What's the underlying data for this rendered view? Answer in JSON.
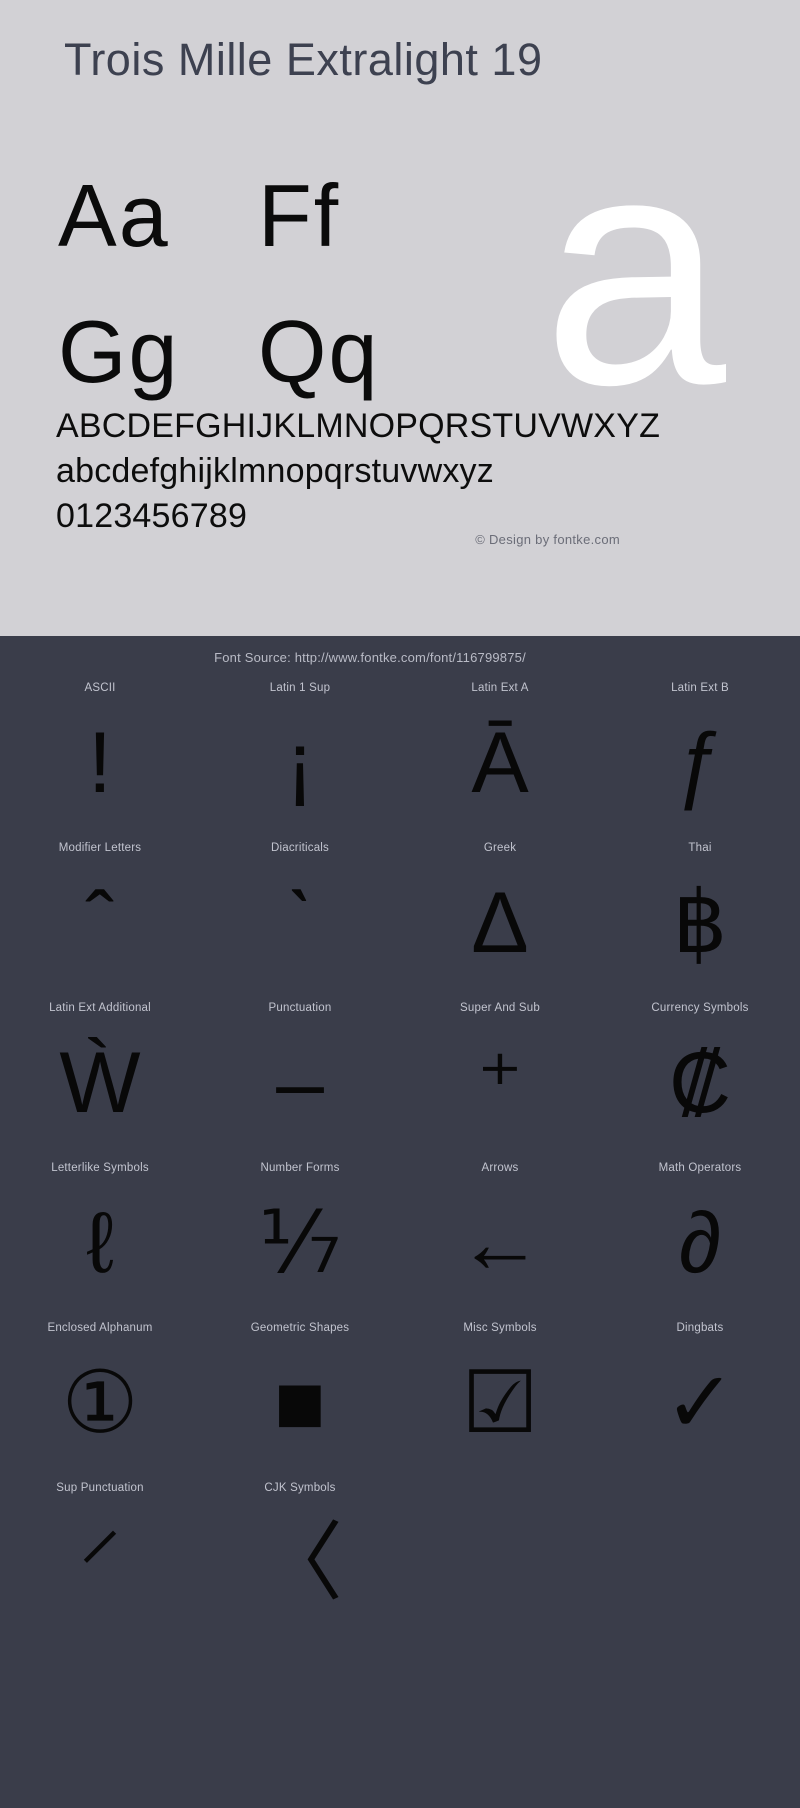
{
  "specimen": {
    "title": "Trois Mille Extralight 19",
    "sample_pairs_row1": [
      "Aa",
      "Ff"
    ],
    "sample_pairs_row2": [
      "Gg",
      "Qq"
    ],
    "ghost_letter": "a",
    "uppercase": "ABCDEFGHIJKLMNOPQRSTUVWXYZ",
    "lowercase": "abcdefghijklmnopqrstuvwxyz",
    "digits": "0123456789",
    "credit": "© Design by fontke.com",
    "background_color": "#d2d1d5",
    "title_color": "#3d4150",
    "glyph_color": "#0b0b0b",
    "ghost_color": "#ffffff"
  },
  "dark_panel": {
    "font_source": "Font Source: http://www.fontke.com/font/116799875/",
    "background_color": "#3a3d4a",
    "label_color": "#c2c4cf",
    "glyph_color": "#080808",
    "rows": [
      [
        {
          "label": "ASCII",
          "glyph": "!"
        },
        {
          "label": "Latin 1 Sup",
          "glyph": "¡"
        },
        {
          "label": "Latin Ext A",
          "glyph": "Ā"
        },
        {
          "label": "Latin Ext B",
          "glyph": "ƒ"
        }
      ],
      [
        {
          "label": "Modifier Letters",
          "glyph": "ˆ"
        },
        {
          "label": "Diacriticals",
          "glyph": "ˋ"
        },
        {
          "label": "Greek",
          "glyph": "Δ"
        },
        {
          "label": "Thai",
          "glyph": "฿"
        }
      ],
      [
        {
          "label": "Latin Ext Additional",
          "glyph": "Ẁ"
        },
        {
          "label": "Punctuation",
          "glyph": "–"
        },
        {
          "label": "Super And Sub",
          "glyph": "⁺"
        },
        {
          "label": "Currency Symbols",
          "glyph": "₡"
        }
      ],
      [
        {
          "label": "Letterlike Symbols",
          "glyph": "ℓ"
        },
        {
          "label": "Number Forms",
          "glyph": "⅐"
        },
        {
          "label": "Arrows",
          "glyph": "←"
        },
        {
          "label": "Math Operators",
          "glyph": "∂"
        }
      ],
      [
        {
          "label": "Enclosed Alphanum",
          "glyph": "①"
        },
        {
          "label": "Geometric Shapes",
          "glyph": "■"
        },
        {
          "label": "Misc Symbols",
          "glyph": "☑"
        },
        {
          "label": "Dingbats",
          "glyph": "✓"
        }
      ],
      [
        {
          "label": "Sup Punctuation",
          "glyph": "⸍"
        },
        {
          "label": "CJK Symbols",
          "glyph": "〈"
        },
        {
          "label": "",
          "glyph": ""
        },
        {
          "label": "",
          "glyph": ""
        }
      ]
    ]
  }
}
